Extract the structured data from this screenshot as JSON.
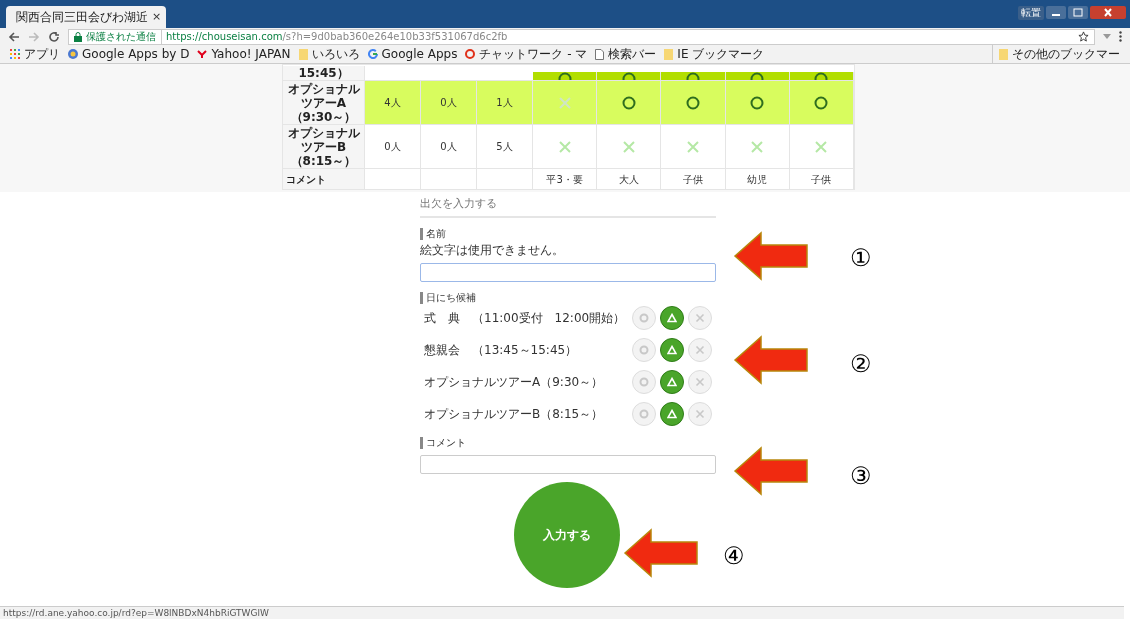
{
  "browser": {
    "tab_title": "関西合同三田会びわ湖近",
    "tab_close": "×",
    "security_label": "保護された通信",
    "url_host": "https://chouseisan.com",
    "url_path": "/s?h=9d0bab360e264e10b33f531067d6c2fb",
    "window_button": "転置",
    "bookmarks": [
      {
        "label": "アプリ",
        "kind": "apps"
      },
      {
        "label": "Google Apps by D",
        "kind": "globe"
      },
      {
        "label": "Yahoo! JAPAN",
        "kind": "yahoo"
      },
      {
        "label": "いろいろ",
        "kind": "folder"
      },
      {
        "label": "Google Apps",
        "kind": "google"
      },
      {
        "label": "チャットワーク - マ",
        "kind": "chat"
      },
      {
        "label": "検索バー",
        "kind": "page"
      },
      {
        "label": "IE ブックマーク",
        "kind": "folder"
      }
    ],
    "other_bookmarks": "その他のブックマー"
  },
  "table": {
    "rows": [
      {
        "label": "15:45）",
        "kind": "best",
        "cut": true,
        "marks": [
          {
            "kind": "circle"
          },
          {
            "kind": "circle"
          },
          {
            "kind": "circle"
          },
          {
            "kind": "circle"
          },
          {
            "kind": "circle"
          }
        ]
      },
      {
        "label": "オプショナルツアーA（9:30～）",
        "kind": "good",
        "cut": false,
        "counts": [
          "4人",
          "0人",
          "1人"
        ],
        "marks": [
          {
            "kind": "cross-faint"
          },
          {
            "kind": "circle"
          },
          {
            "kind": "circle"
          },
          {
            "kind": "circle"
          },
          {
            "kind": "circle"
          }
        ]
      },
      {
        "label": "オプショナルツアーB（8:15～）",
        "kind": "plain",
        "cut": false,
        "counts": [
          "0人",
          "0人",
          "5人"
        ],
        "marks": [
          {
            "kind": "cross"
          },
          {
            "kind": "cross"
          },
          {
            "kind": "cross"
          },
          {
            "kind": "cross"
          },
          {
            "kind": "cross"
          }
        ]
      }
    ],
    "comment_row": {
      "label": "コメント",
      "cells": [
        "",
        "",
        "",
        "平3・要",
        "大人",
        "子供",
        "幼児",
        "子供"
      ]
    }
  },
  "form": {
    "title": "出欠を入力する",
    "name_label": "名前",
    "name_hint": "絵文字は使用できません。",
    "dates_label": "日にち候補",
    "dates": [
      {
        "label": "式　典　（11:00受付　12:00開始）",
        "choices": [
          {
            "kind": "circle",
            "selected": false
          },
          {
            "kind": "triangle",
            "selected": true
          },
          {
            "kind": "cross",
            "selected": false
          }
        ]
      },
      {
        "label": "懇親会　（13:45～15:45）",
        "choices": [
          {
            "kind": "circle",
            "selected": false
          },
          {
            "kind": "triangle",
            "selected": true
          },
          {
            "kind": "cross",
            "selected": false
          }
        ]
      },
      {
        "label": "オプショナルツアーA（9:30～）",
        "choices": [
          {
            "kind": "circle",
            "selected": false
          },
          {
            "kind": "triangle",
            "selected": true
          },
          {
            "kind": "cross",
            "selected": false
          }
        ]
      },
      {
        "label": "オプショナルツアーB（8:15～）",
        "choices": [
          {
            "kind": "circle",
            "selected": false
          },
          {
            "kind": "triangle",
            "selected": true
          },
          {
            "kind": "cross",
            "selected": false
          }
        ]
      }
    ],
    "comment_label": "コメント",
    "submit": "入力する"
  },
  "annotations": [
    "①",
    "②",
    "③",
    "④"
  ],
  "status_bar": "https://rd.ane.yahoo.co.jp/rd?ep=W8lNBDxN4hbRiGTWGlW"
}
